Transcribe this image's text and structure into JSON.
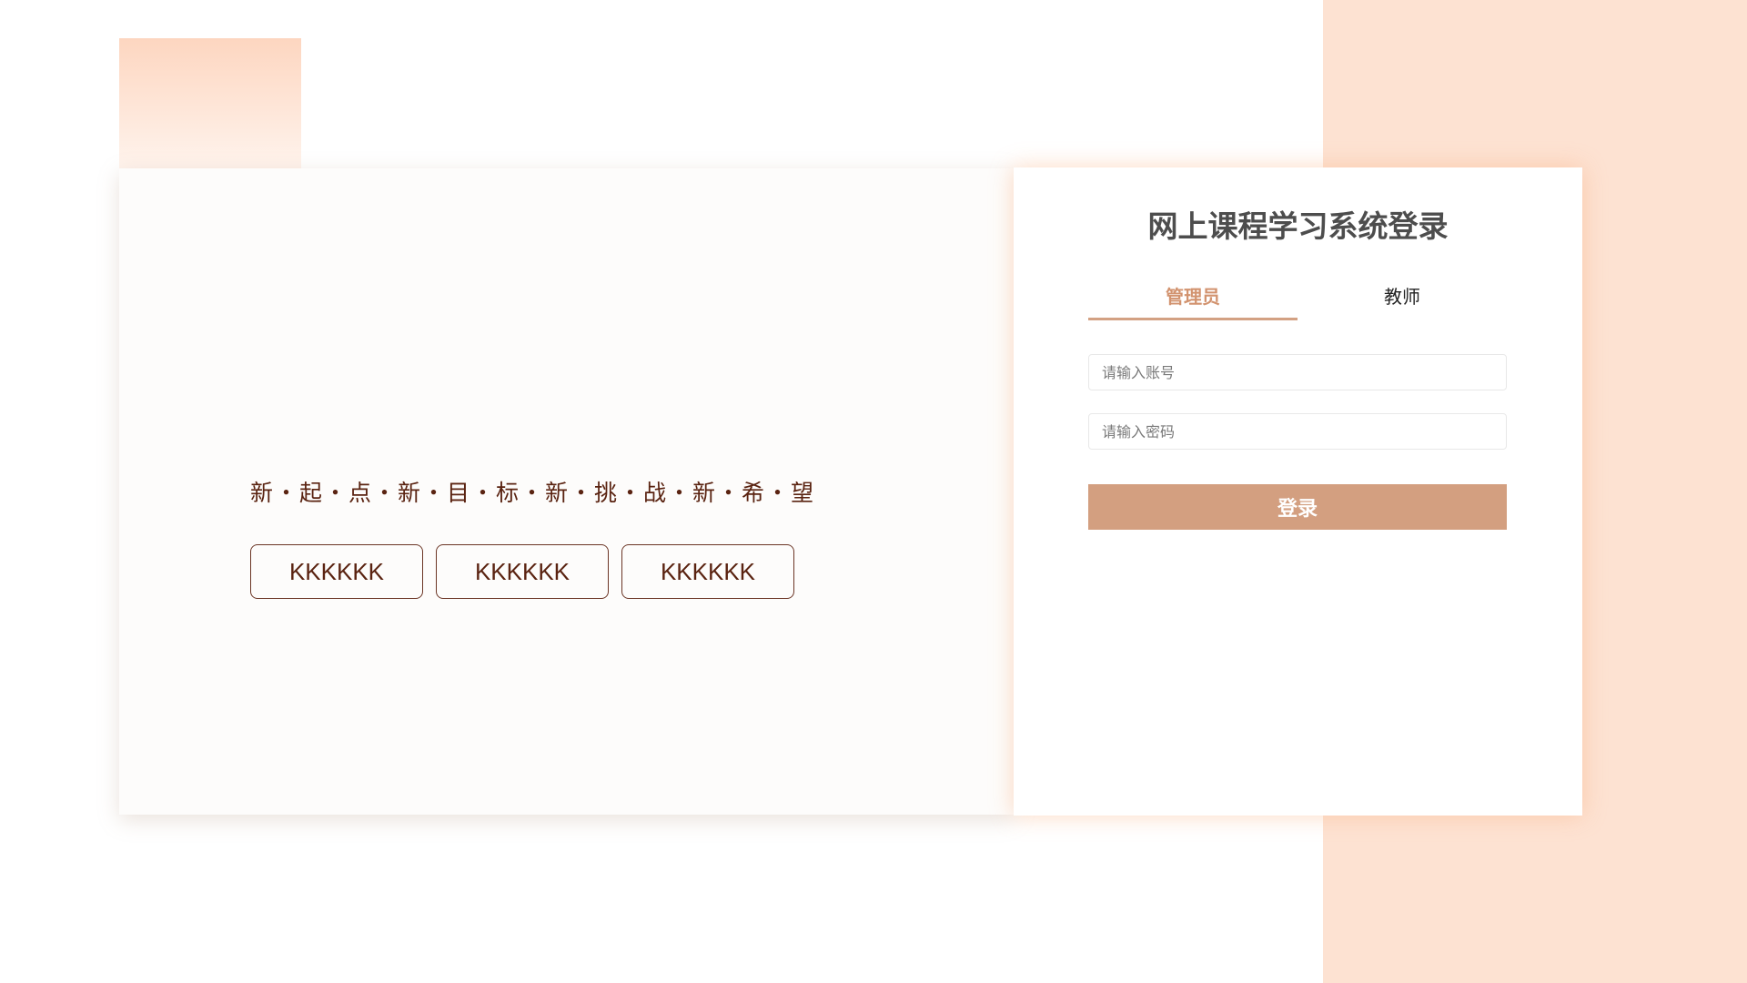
{
  "hero": {
    "slogan": "新・起・点・新・目・标・新・挑・战・新・希・望",
    "buttons": [
      "KKKKKK",
      "KKKKKK",
      "KKKKKK"
    ]
  },
  "login": {
    "title": "网上课程学习系统登录",
    "tabs": [
      {
        "label": "管理员",
        "active": true
      },
      {
        "label": "教师",
        "active": false
      }
    ],
    "account_placeholder": "请输入账号",
    "password_placeholder": "请输入密码",
    "submit_label": "登录"
  },
  "colors": {
    "accent": "#d39f80",
    "accent_text": "#d2936f",
    "peach_bg": "#fde2d2",
    "slogan_text": "#5a2311",
    "title_text": "#4d4d4d"
  }
}
